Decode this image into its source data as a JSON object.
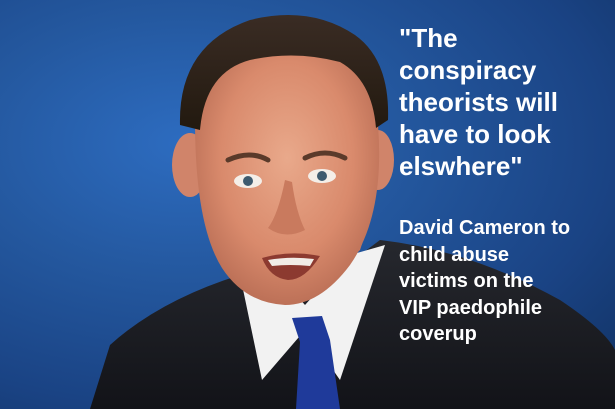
{
  "overlay": {
    "quote": "\"The\nconspiracy\ntheorists will\nhave to look\nelswhere\"",
    "caption": "David Cameron to\nchild abuse\nvictims on the\nVIP paedophile\ncoverup"
  },
  "colors": {
    "background": "#1f4f96",
    "text": "#ffffff"
  }
}
